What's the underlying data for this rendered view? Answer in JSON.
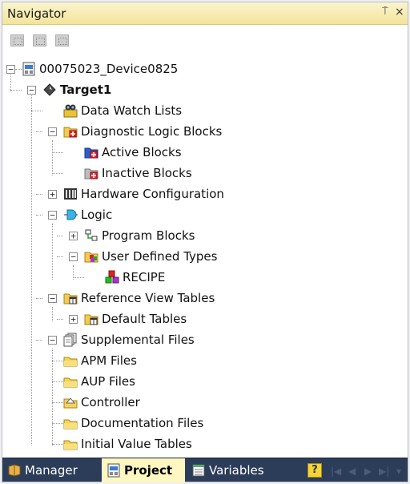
{
  "panel": {
    "title": "Navigator",
    "pin_glyph": "⍑",
    "close_glyph": "×"
  },
  "tree": {
    "device": "00075023_Device0825",
    "target": "Target1",
    "data_watch_lists": "Data Watch Lists",
    "diagnostic_logic_blocks": "Diagnostic Logic Blocks",
    "active_blocks": "Active Blocks",
    "inactive_blocks": "Inactive Blocks",
    "hardware_configuration": "Hardware Configuration",
    "logic": "Logic",
    "program_blocks": "Program Blocks",
    "user_defined_types": "User Defined Types",
    "recipe": "RECIPE",
    "reference_view_tables": "Reference View Tables",
    "default_tables": "Default Tables",
    "supplemental_files": "Supplemental Files",
    "apm_files": "APM Files",
    "aup_files": "AUP Files",
    "controller": "Controller",
    "documentation_files": "Documentation Files",
    "initial_value_tables": "Initial Value Tables"
  },
  "tabs": {
    "manager": "Manager",
    "project": "Project",
    "variables": "Variables",
    "help_glyph": "?"
  },
  "colors": {
    "title_bg": "#f3e49a",
    "bottom_bar": "#2c3d5a",
    "active_tab": "#fff7c2"
  }
}
